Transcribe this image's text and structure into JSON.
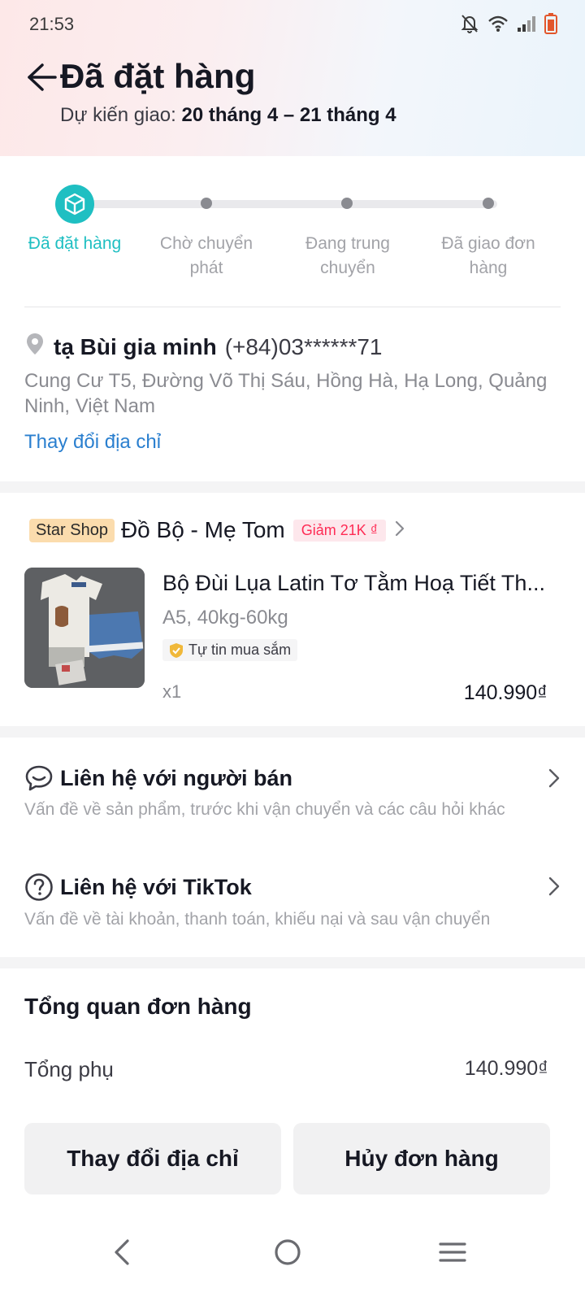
{
  "status_bar": {
    "time": "21:53",
    "icons": [
      "bell-muted-icon",
      "wifi-icon",
      "signal-icon",
      "battery-icon"
    ]
  },
  "header": {
    "title": "Đã đặt hàng",
    "eta_label": "Dự kiến giao:",
    "eta_value": "20 tháng 4 – 21 tháng 4"
  },
  "progress": {
    "steps": [
      {
        "label": "Đã đặt hàng",
        "active": true
      },
      {
        "label": "Chờ chuyển phát",
        "active": false
      },
      {
        "label": "Đang trung chuyển",
        "active": false
      },
      {
        "label": "Đã giao đơn hàng",
        "active": false
      }
    ],
    "accent_color": "#1fbfc2"
  },
  "address": {
    "name": "tạ Bùi gia minh",
    "phone": "(+84)03******71",
    "detail": "Cung Cư T5, Đường Võ Thị Sáu, Hồng Hà, Hạ Long, Quảng Ninh, Việt Nam",
    "change_link": "Thay đổi địa chỉ"
  },
  "shop": {
    "badge": "Star Shop",
    "name": "Đồ Bộ - Mẹ Tom",
    "discount": "Giảm 21K ₫"
  },
  "product": {
    "title": "Bộ Đùi Lụa Latin Tơ Tằm Hoạ Tiết Th...",
    "variant": "A5, 40kg-60kg",
    "trust_badge": "Tự tin mua sắm",
    "quantity": "x1",
    "price": "140.990₫"
  },
  "contacts": [
    {
      "title": "Liên hệ với người bán",
      "subtitle": "Vấn đề về sản phẩm, trước khi vận chuyển và các câu hỏi khác",
      "icon": "chat-bubble-icon"
    },
    {
      "title": "Liên hệ với TikTok",
      "subtitle": "Vấn đề về tài khoản, thanh toán, khiếu nại và sau vận chuyển",
      "icon": "question-circle-icon"
    }
  ],
  "overview": {
    "title": "Tổng quan đơn hàng",
    "subtotal_label": "Tổng phụ",
    "subtotal_value": "140.990₫"
  },
  "actions": {
    "change_address": "Thay đổi địa chỉ",
    "cancel_order": "Hủy đơn hàng"
  },
  "nav_bar": [
    "back-nav-icon",
    "home-nav-icon",
    "menu-nav-icon"
  ],
  "colors": {
    "accent_teal": "#1fbfc2",
    "link_blue": "#2a7fcf",
    "discount_red": "#fe2c55",
    "shop_badge_bg": "#fbdcad"
  }
}
